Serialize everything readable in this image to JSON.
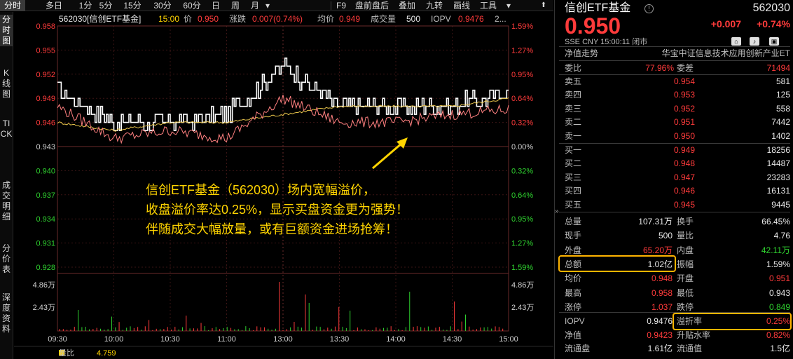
{
  "tabs": [
    "分时",
    "多日",
    "1分",
    "5分",
    "15分",
    "30分",
    "60分",
    "日",
    "周",
    "月"
  ],
  "tabs_right": [
    "F9",
    "盘前盘后",
    "叠加",
    "九转",
    "画线",
    "工具"
  ],
  "sidebar": [
    "分时图",
    "K线图",
    "TICK",
    "成交明细",
    "分价表",
    "深度资料"
  ],
  "info": {
    "code": "562030[信创ETF基金]",
    "time": "15:00",
    "price_label": "价",
    "price": "0.950",
    "chg_label": "涨跌",
    "chg": "0.007(0.74%)",
    "avg_label": "均价",
    "avg": "0.949",
    "vol_label": "成交量",
    "vol": "500",
    "iopv_label": "IOPV",
    "iopv": "0.9476",
    "more": "2..."
  },
  "axis": {
    "left": [
      "0.958",
      "0.955",
      "0.952",
      "0.949",
      "0.946",
      "0.943",
      "0.940",
      "0.937",
      "0.934",
      "0.931",
      "0.928"
    ],
    "right": [
      "1.59%",
      "1.27%",
      "0.95%",
      "0.64%",
      "0.32%",
      "0.00%",
      "0.32%",
      "0.64%",
      "0.95%",
      "1.27%",
      "1.59%"
    ],
    "vol_left": [
      "4.86万",
      "2.43万"
    ],
    "vol_right": [
      "4.86万",
      "2.43万"
    ],
    "time": [
      "09:30",
      "10:00",
      "10:30",
      "11:00",
      "13:00",
      "13:30",
      "14:00",
      "14:30",
      "15:00"
    ]
  },
  "bottom": {
    "label": "量比",
    "value": "4.759"
  },
  "annotation": [
    "信创ETF基金（562030）场内宽幅溢价，",
    "收盘溢价率达0.25%，显示买盘资金更为强势！",
    "伴随成交大幅放量，或有巨额资金进场抢筹！"
  ],
  "colors": {
    "up": "#ff3b3b",
    "down": "#2fd12f",
    "price_line": "#ffffff",
    "avg_line": "#e6c24a",
    "iopv_line": "#ff8080",
    "annot": "#ffd400",
    "highlight": "#ffb400"
  },
  "chart_data": {
    "type": "line",
    "x": [
      "09:30",
      "10:00",
      "10:30",
      "11:00",
      "11:30/13:00",
      "13:30",
      "14:00",
      "14:30",
      "15:00"
    ],
    "ylim": [
      0.928,
      0.958
    ],
    "prev_close": 0.943,
    "series": [
      {
        "name": "价",
        "values": [
          0.95,
          0.946,
          0.946,
          0.947,
          0.953,
          0.948,
          0.948,
          0.948,
          0.95
        ]
      },
      {
        "name": "均价",
        "values": [
          0.946,
          0.945,
          0.946,
          0.946,
          0.947,
          0.948,
          0.948,
          0.948,
          0.949
        ]
      },
      {
        "name": "IOPV",
        "values": [
          0.948,
          0.944,
          0.945,
          0.944,
          0.949,
          0.946,
          0.946,
          0.947,
          0.9476
        ]
      }
    ]
  },
  "quote": {
    "name": "信创ETF基金",
    "code": "562030",
    "price": "0.950",
    "change": "+0.007",
    "change_pct": "+0.74%",
    "meta": "SSE  CNY  15:00:11  闭市",
    "nav_trend": "净值走势",
    "fund_full": "华宝中证信息技术应用创新产业ET",
    "weibi_label": "委比",
    "weibi": "77.96%",
    "weicha_label": "委差",
    "weicha": "71494",
    "asks": [
      {
        "label": "卖五",
        "price": "0.954",
        "vol": "581"
      },
      {
        "label": "卖四",
        "price": "0.953",
        "vol": "125"
      },
      {
        "label": "卖三",
        "price": "0.952",
        "vol": "558"
      },
      {
        "label": "卖二",
        "price": "0.951",
        "vol": "7442"
      },
      {
        "label": "卖一",
        "price": "0.950",
        "vol": "1402"
      }
    ],
    "bids": [
      {
        "label": "买一",
        "price": "0.949",
        "vol": "18256"
      },
      {
        "label": "买二",
        "price": "0.948",
        "vol": "14487"
      },
      {
        "label": "买三",
        "price": "0.947",
        "vol": "23283"
      },
      {
        "label": "买四",
        "price": "0.946",
        "vol": "16131"
      },
      {
        "label": "买五",
        "price": "0.945",
        "vol": "9445"
      }
    ],
    "stats": [
      {
        "l1": "总量",
        "v1": "107.31万",
        "c1": "white",
        "l2": "换手",
        "v2": "66.45%",
        "c2": "white"
      },
      {
        "l1": "现手",
        "v1": "500",
        "c1": "white",
        "l2": "量比",
        "v2": "4.76",
        "c2": "white"
      },
      {
        "l1": "外盘",
        "v1": "65.20万",
        "c1": "red",
        "l2": "内盘",
        "v2": "42.11万",
        "c2": "green"
      },
      {
        "l1": "总额",
        "v1": "1.02亿",
        "c1": "white",
        "l2": "振幅",
        "v2": "1.59%",
        "c2": "white"
      },
      {
        "l1": "均价",
        "v1": "0.948",
        "c1": "red",
        "l2": "开盘",
        "v2": "0.951",
        "c2": "red"
      },
      {
        "l1": "最高",
        "v1": "0.958",
        "c1": "red",
        "l2": "最低",
        "v2": "0.943",
        "c2": "white"
      },
      {
        "l1": "涨停",
        "v1": "1.037",
        "c1": "red",
        "l2": "跌停",
        "v2": "0.849",
        "c2": "green"
      }
    ],
    "stats2": [
      {
        "l1": "IOPV",
        "v1": "0.9476",
        "c1": "white",
        "l2": "溢折率",
        "v2": "0.25%",
        "c2": "red"
      },
      {
        "l1": "净值",
        "v1": "0.9423",
        "c1": "red",
        "l2": "升贴水率",
        "v2": "0.82%",
        "c2": "red"
      },
      {
        "l1": "流通盘",
        "v1": "1.61亿",
        "c1": "white",
        "l2": "流通值",
        "v2": "1.5亿",
        "c2": "white"
      }
    ]
  }
}
